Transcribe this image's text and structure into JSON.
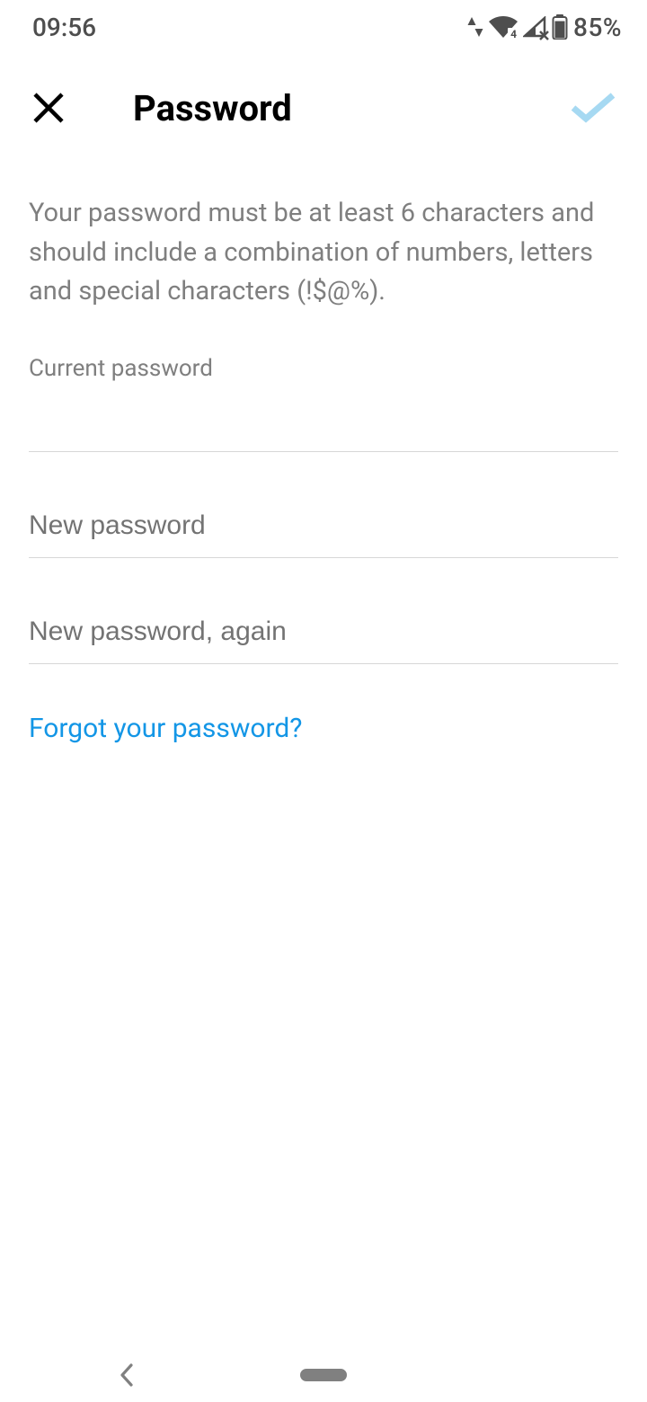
{
  "status_bar": {
    "time": "09:56",
    "network_badge": "4",
    "battery_text": "85%"
  },
  "header": {
    "title": "Password"
  },
  "content": {
    "description": "Your password must be at least 6 characters and should include a combination of numbers, letters and special characters (!$@%).",
    "current_password_label": "Current password",
    "new_password_placeholder": "New password",
    "new_password_again_placeholder": "New password, again",
    "forgot_link": "Forgot your password?"
  },
  "colors": {
    "link": "#1396e6",
    "confirm_icon": "#a6d9f2"
  }
}
